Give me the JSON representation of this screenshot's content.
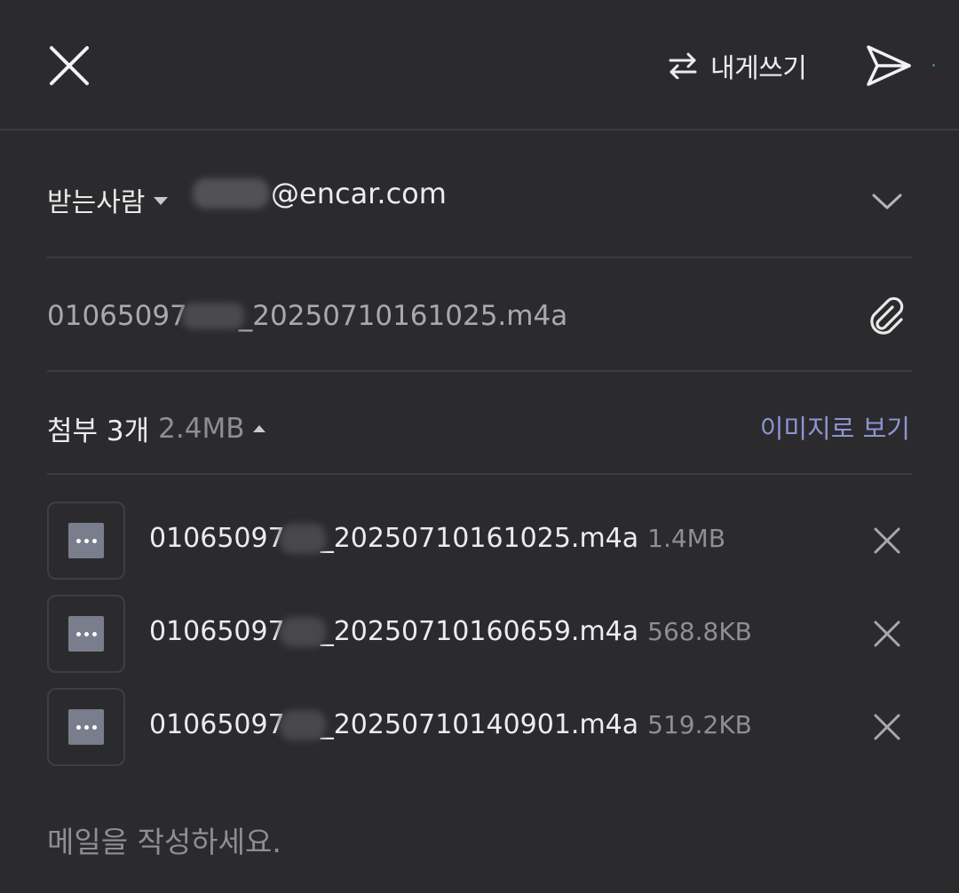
{
  "topbar": {
    "self_send_label": "내게쓰기"
  },
  "recipient": {
    "label": "받는사람",
    "email_domain": "@encar.com"
  },
  "subject": {
    "prefix": "01065097",
    "suffix": "_20250710161025.m4a"
  },
  "attachments": {
    "count_label": "첨부 3개",
    "total_size": "2.4MB",
    "view_images_label": "이미지로 보기",
    "items": [
      {
        "name_prefix": "01065097",
        "name_suffix": "_20250710161025.m4a",
        "size": "1.4MB"
      },
      {
        "name_prefix": "01065097",
        "name_suffix": "_20250710160659.m4a",
        "size": "568.8KB"
      },
      {
        "name_prefix": "01065097",
        "name_suffix": "_20250710140901.m4a",
        "size": "519.2KB"
      }
    ]
  },
  "body": {
    "placeholder": "메일을 작성하세요."
  },
  "colors": {
    "background": "#2b2b2d",
    "divider": "#3d3d40",
    "accent_link": "#8f93d4",
    "muted_text": "#8e8e93"
  }
}
